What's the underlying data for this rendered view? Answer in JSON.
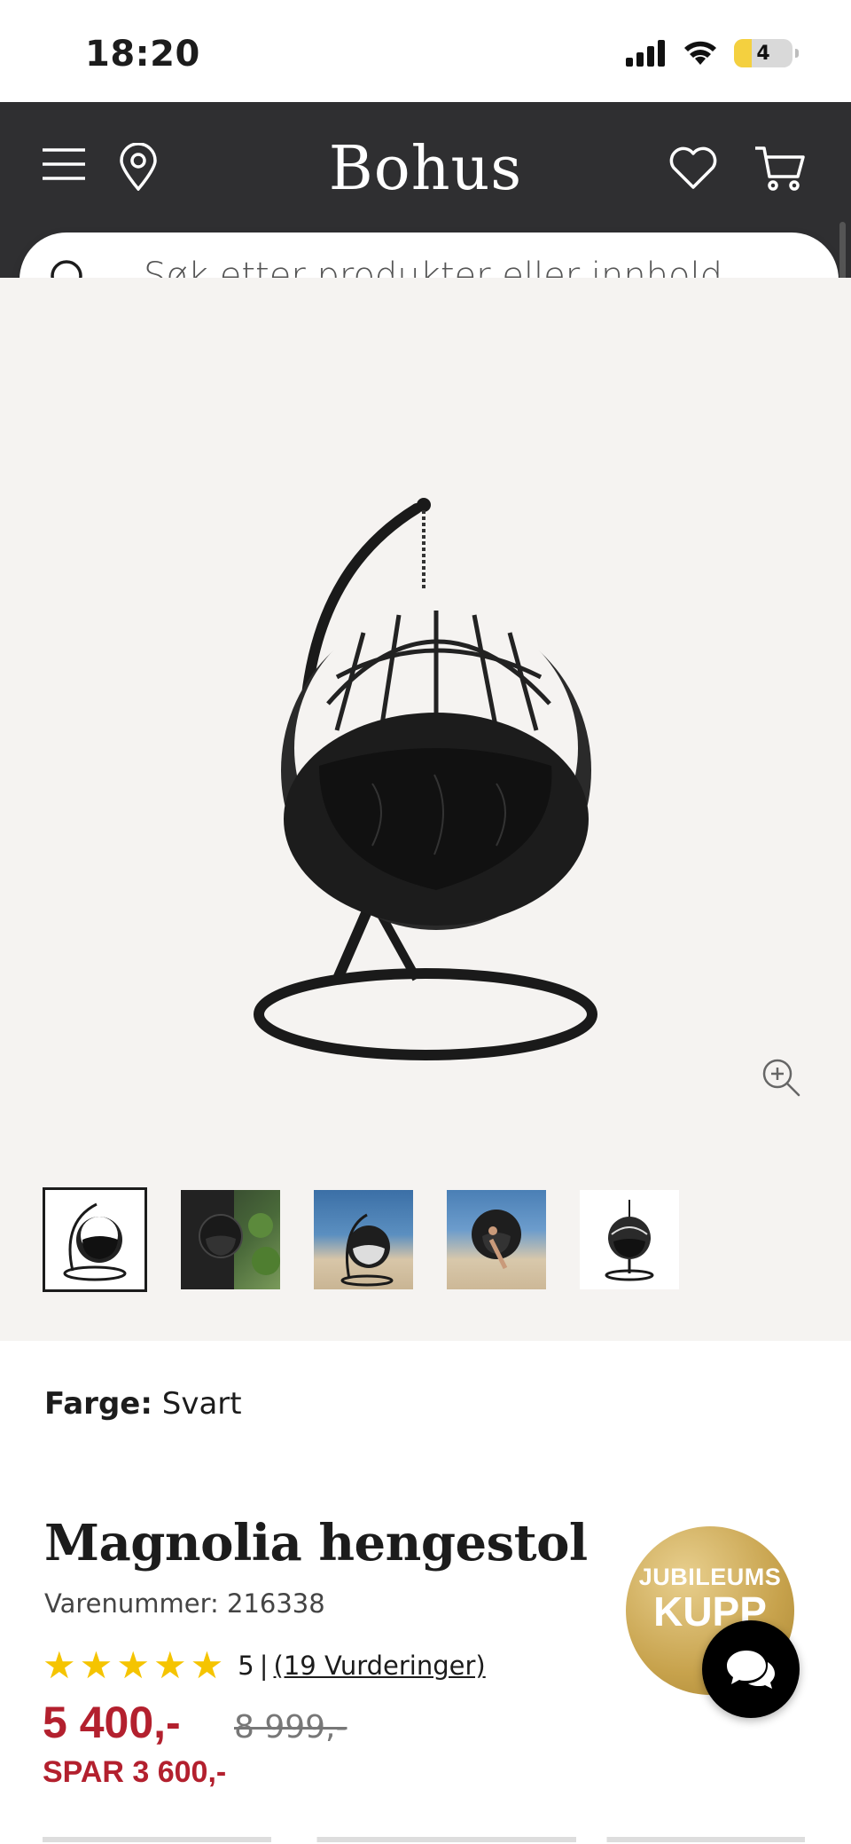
{
  "status_bar": {
    "time": "18:20",
    "battery_level": "4"
  },
  "header": {
    "logo": "Bohus"
  },
  "search": {
    "placeholder": "Søk etter produkter eller innhold ..."
  },
  "gallery": {
    "thumbnails": [
      "thumb-1",
      "thumb-2",
      "thumb-3",
      "thumb-4",
      "thumb-5"
    ],
    "selected_index": 0
  },
  "product": {
    "color_label": "Farge:",
    "color_value": "Svart",
    "title": "Magnolia hengestol",
    "sku": "Varenummer: 216338",
    "rating_value": "5",
    "rating_separator": "|",
    "rating_count_text": "(19 Vurderinger)",
    "stars": 5,
    "price": "5 400,-",
    "old_price": "8 999,-",
    "saving": "SPAR 3 600,-"
  },
  "badge": {
    "line1": "JUBILEUMS",
    "line2": "KUPP"
  },
  "colors": {
    "header_bg": "#2f2f31",
    "price_red": "#b3202e",
    "star_yellow": "#f5c400",
    "gallery_bg": "#f5f3f1"
  }
}
